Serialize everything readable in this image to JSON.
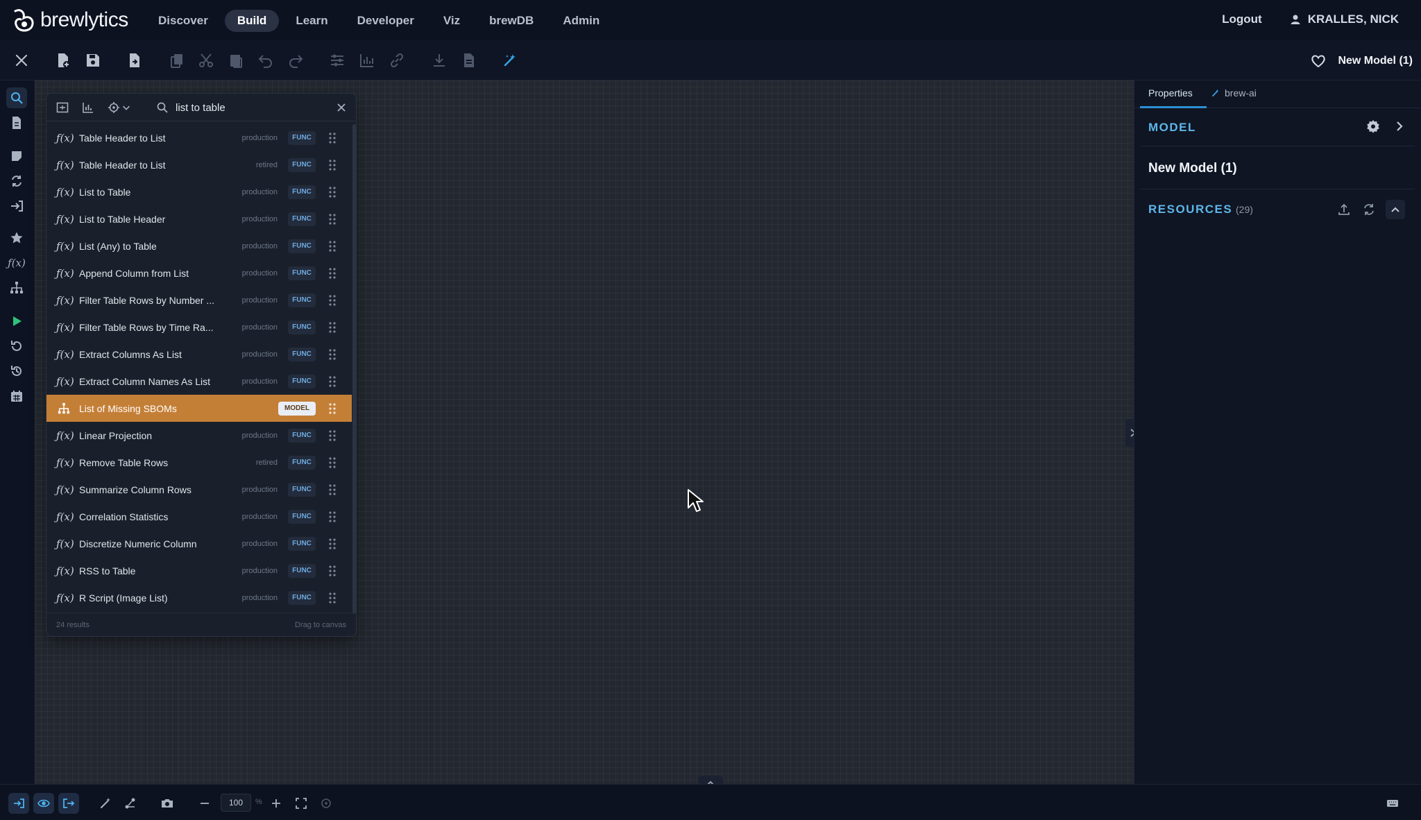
{
  "app": {
    "logo_text": "brewlytics"
  },
  "nav": {
    "items": [
      "Discover",
      "Build",
      "Learn",
      "Developer",
      "Viz",
      "brewDB",
      "Admin"
    ],
    "active": "Build"
  },
  "header": {
    "logout": "Logout",
    "user": "KRALLES, NICK"
  },
  "toolbar": {
    "model_title": "New Model (1)"
  },
  "search": {
    "query": "list to table",
    "results_count": "24 results",
    "hint": "Drag to canvas"
  },
  "results": [
    {
      "name": "Table Header to List",
      "status": "production",
      "tag": "FUNC",
      "kind": "function"
    },
    {
      "name": "Table Header to List",
      "status": "retired",
      "tag": "FUNC",
      "kind": "function"
    },
    {
      "name": "List to Table",
      "status": "production",
      "tag": "FUNC",
      "kind": "function"
    },
    {
      "name": "List to Table Header",
      "status": "production",
      "tag": "FUNC",
      "kind": "function"
    },
    {
      "name": "List (Any) to Table",
      "status": "production",
      "tag": "FUNC",
      "kind": "function"
    },
    {
      "name": "Append Column from List",
      "status": "production",
      "tag": "FUNC",
      "kind": "function"
    },
    {
      "name": "Filter Table Rows by Number ...",
      "status": "production",
      "tag": "FUNC",
      "kind": "function"
    },
    {
      "name": "Filter Table Rows by Time Ra...",
      "status": "production",
      "tag": "FUNC",
      "kind": "function"
    },
    {
      "name": "Extract Columns As List",
      "status": "production",
      "tag": "FUNC",
      "kind": "function"
    },
    {
      "name": "Extract Column Names As List",
      "status": "production",
      "tag": "FUNC",
      "kind": "function"
    },
    {
      "name": "List of Missing SBOMs",
      "status": "",
      "tag": "MODEL",
      "kind": "model",
      "selected": true
    },
    {
      "name": "Linear Projection",
      "status": "production",
      "tag": "FUNC",
      "kind": "function"
    },
    {
      "name": "Remove Table Rows",
      "status": "retired",
      "tag": "FUNC",
      "kind": "function"
    },
    {
      "name": "Summarize Column Rows",
      "status": "production",
      "tag": "FUNC",
      "kind": "function"
    },
    {
      "name": "Correlation Statistics",
      "status": "production",
      "tag": "FUNC",
      "kind": "function"
    },
    {
      "name": "Discretize Numeric Column",
      "status": "production",
      "tag": "FUNC",
      "kind": "function"
    },
    {
      "name": "RSS to Table",
      "status": "production",
      "tag": "FUNC",
      "kind": "function"
    },
    {
      "name": "R Script (Image List)",
      "status": "production",
      "tag": "FUNC",
      "kind": "function"
    }
  ],
  "right_panel": {
    "tabs": [
      "Properties",
      "brew-ai"
    ],
    "model_section": "MODEL",
    "model_name": "New Model (1)",
    "resources_section": "RESOURCES",
    "resources_count": "(29)"
  },
  "bottombar": {
    "zoom": "100",
    "zoom_unit": "%"
  },
  "colors": {
    "accent_blue": "#5eb6ea",
    "selected_row": "#c47f37",
    "run_green": "#2ec27e"
  }
}
